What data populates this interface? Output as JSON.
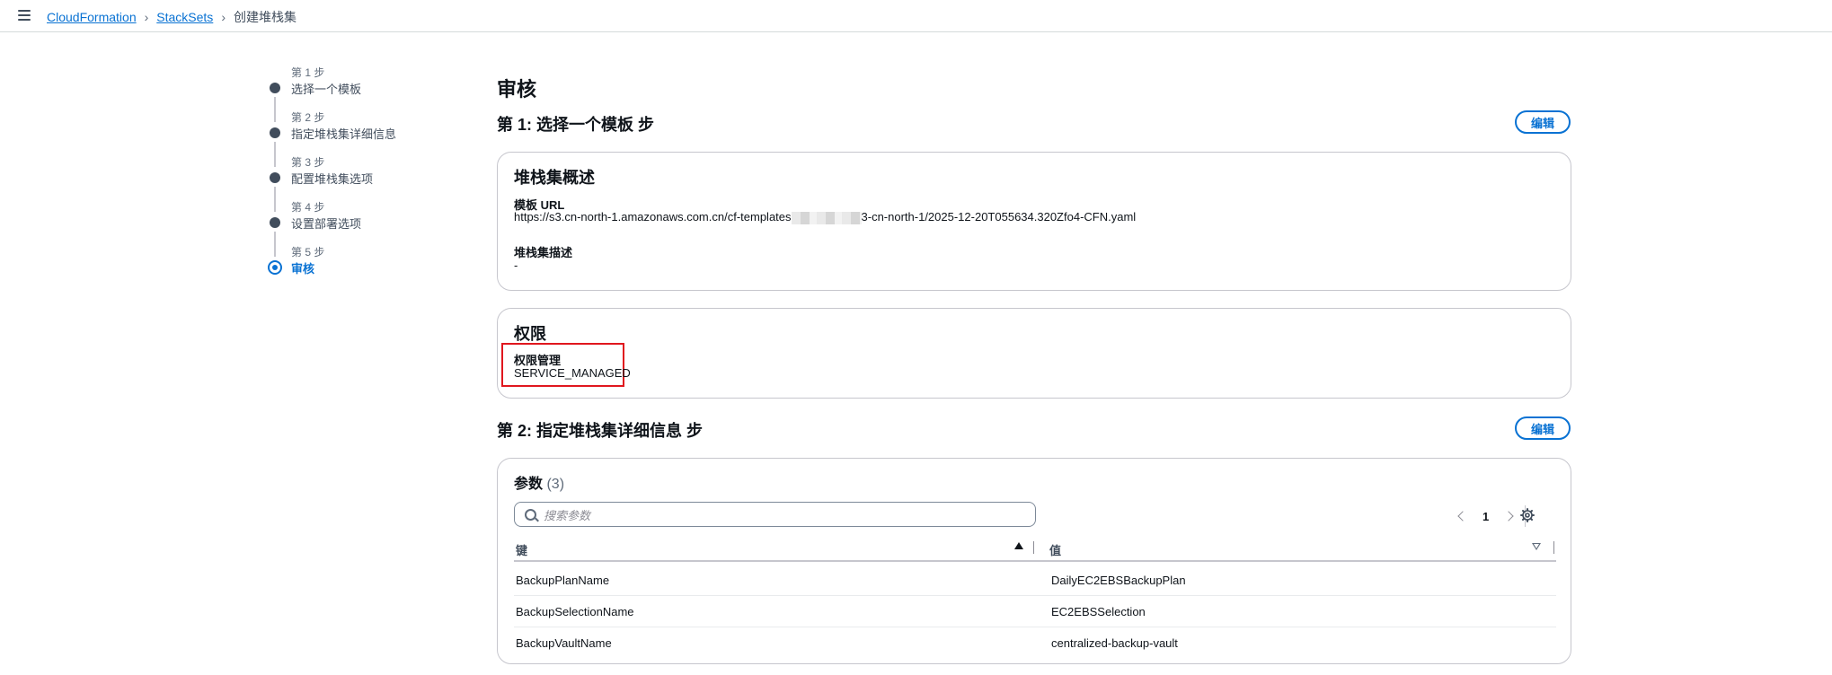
{
  "breadcrumb": {
    "items": [
      "CloudFormation",
      "StackSets"
    ],
    "current": "创建堆栈集"
  },
  "steps": [
    {
      "num": "第 1 步",
      "title": "选择一个模板"
    },
    {
      "num": "第 2 步",
      "title": "指定堆栈集详细信息"
    },
    {
      "num": "第 3 步",
      "title": "配置堆栈集选项"
    },
    {
      "num": "第 4 步",
      "title": "设置部署选项"
    },
    {
      "num": "第 5 步",
      "title": "审核"
    }
  ],
  "page_title": "审核",
  "section1": {
    "title": "第 1: 选择一个模板 步",
    "edit_label": "编辑",
    "overview": {
      "title": "堆栈集概述",
      "template_url_label": "模板 URL",
      "template_url_prefix": "https://s3.cn-north-1.amazonaws.com.cn/cf-templates",
      "template_url_suffix": "3-cn-north-1/2025-12-20T055634.320Zfo4-CFN.yaml",
      "description_label": "堆栈集描述",
      "description_value": "-"
    },
    "permissions": {
      "title": "权限",
      "model_label": "权限管理",
      "model_value": "SERVICE_MANAGED"
    }
  },
  "section2": {
    "title": "第 2: 指定堆栈集详细信息 步",
    "edit_label": "编辑",
    "params": {
      "title": "参数",
      "count": "(3)",
      "search_placeholder": "搜索参数",
      "page": "1",
      "columns": [
        "键",
        "值"
      ],
      "rows": [
        {
          "key": "BackupPlanName",
          "value": "DailyEC2EBSBackupPlan"
        },
        {
          "key": "BackupSelectionName",
          "value": "EC2EBSSelection"
        },
        {
          "key": "BackupVaultName",
          "value": "centralized-backup-vault"
        }
      ]
    }
  },
  "colors": {
    "accent": "#0972d3",
    "highlight": "#e0171e"
  }
}
